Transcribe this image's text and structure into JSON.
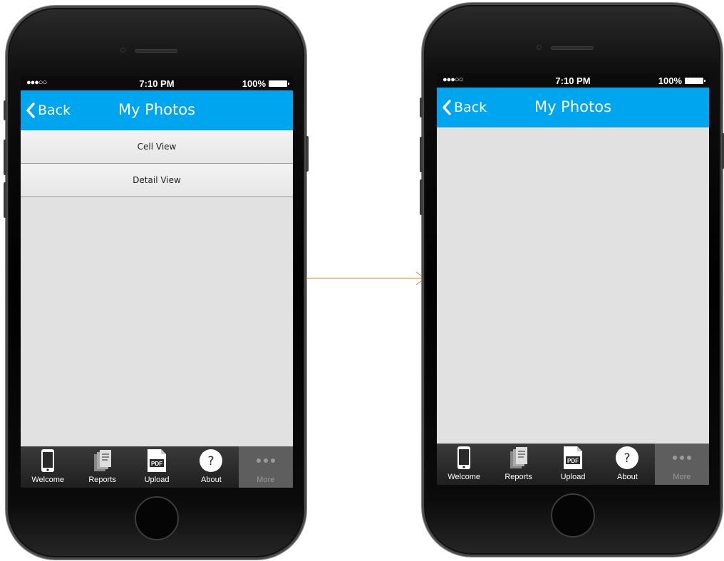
{
  "screens": [
    {
      "status_bar": {
        "signal": "●●●○○",
        "time": "7:10 PM",
        "battery": "100%"
      },
      "nav": {
        "back_label": "Back",
        "title": "My Photos"
      },
      "list_items": [
        {
          "label": "Cell View"
        },
        {
          "label": "Detail View"
        }
      ],
      "tabs": [
        {
          "label": "Welcome",
          "icon": "phone-icon"
        },
        {
          "label": "Reports",
          "icon": "reports-icon"
        },
        {
          "label": "Upload",
          "icon": "pdf-icon",
          "icon_text": "PDF"
        },
        {
          "label": "About",
          "icon": "question-icon",
          "icon_text": "?"
        },
        {
          "label": "More",
          "icon": "more-icon"
        }
      ]
    },
    {
      "status_bar": {
        "signal": "●●●○○",
        "time": "7:10 PM",
        "battery": "100%"
      },
      "nav": {
        "back_label": "Back",
        "title": "My Photos"
      },
      "list_items": [],
      "tabs": [
        {
          "label": "Welcome",
          "icon": "phone-icon"
        },
        {
          "label": "Reports",
          "icon": "reports-icon"
        },
        {
          "label": "Upload",
          "icon": "pdf-icon",
          "icon_text": "PDF"
        },
        {
          "label": "About",
          "icon": "question-icon",
          "icon_text": "?"
        },
        {
          "label": "More",
          "icon": "more-icon"
        }
      ]
    }
  ],
  "colors": {
    "nav_bar": "#00a5ef",
    "screen_bg": "#e1e1e1",
    "tab_bar": "#2a2a2a",
    "tab_more": "#5e5e5e",
    "connector": "#e67e22"
  }
}
